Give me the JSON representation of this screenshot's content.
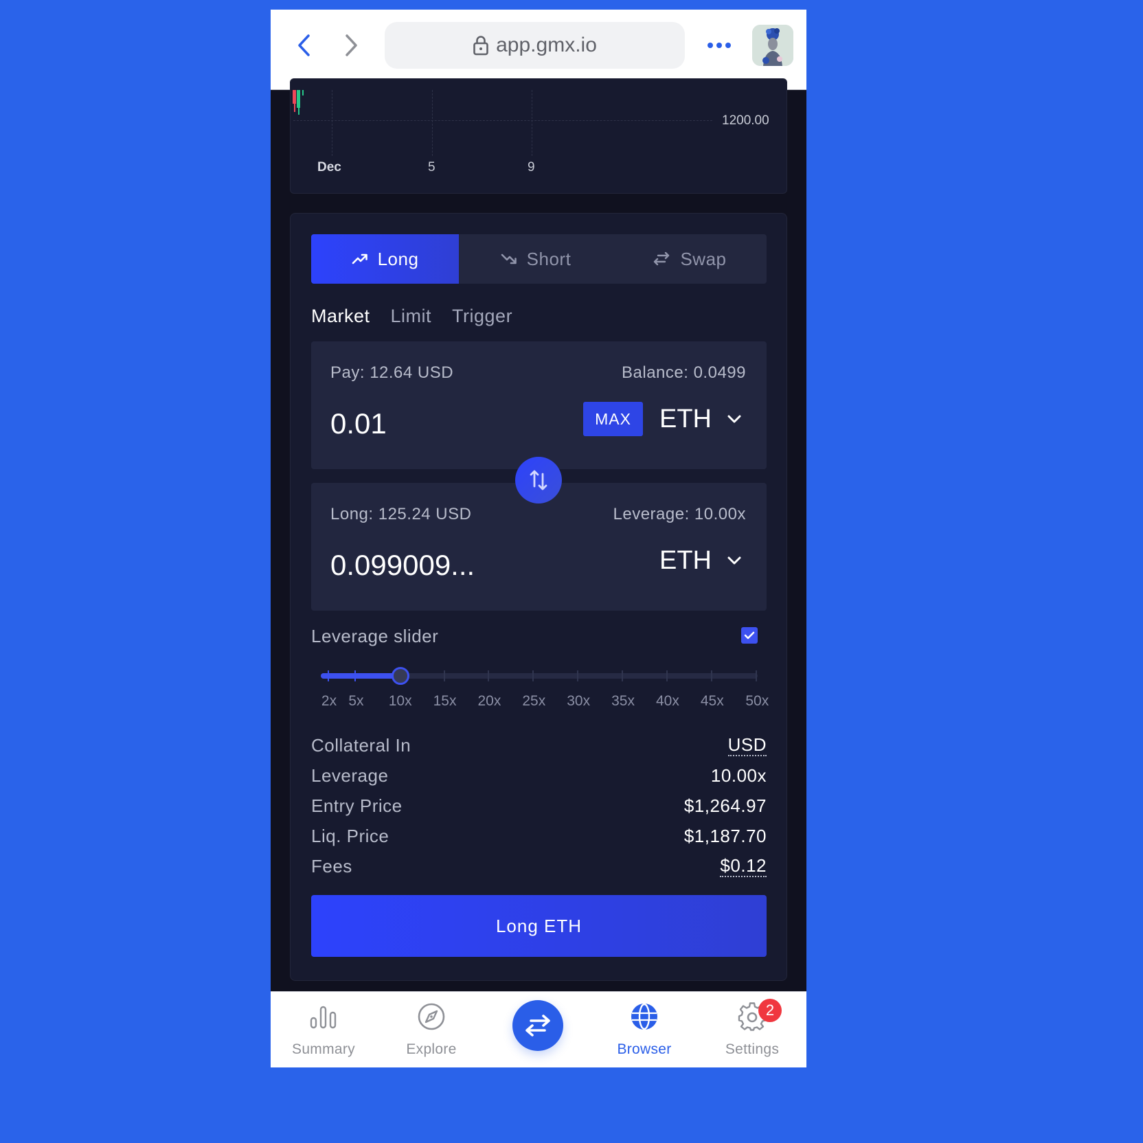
{
  "browser": {
    "url": "app.gmx.io",
    "icons": {
      "back": "chevron-left-icon",
      "forward": "chevron-right-icon",
      "lock": "lock-icon",
      "more": "more-horizontal-icon",
      "avatar": "avatar"
    }
  },
  "chart": {
    "price_label": "1200.00",
    "date_labels": [
      "Dec",
      "5",
      "9"
    ]
  },
  "trade": {
    "type_tabs": [
      {
        "label": "Long",
        "icon": "trend-up-icon",
        "active": true
      },
      {
        "label": "Short",
        "icon": "trend-down-icon",
        "active": false
      },
      {
        "label": "Swap",
        "icon": "swap-arrows-icon",
        "active": false
      }
    ],
    "order_tabs": [
      {
        "label": "Market",
        "active": true
      },
      {
        "label": "Limit",
        "active": false
      },
      {
        "label": "Trigger",
        "active": false
      }
    ],
    "pay": {
      "label": "Pay: 12.64 USD",
      "balance": "Balance: 0.0499",
      "value": "0.01",
      "max_label": "MAX",
      "token": "ETH"
    },
    "receive": {
      "label": "Long: 125.24 USD",
      "leverage": "Leverage: 10.00x",
      "value": "0.099009...",
      "token": "ETH"
    },
    "leverage_slider": {
      "label": "Leverage slider",
      "enabled": true,
      "value": 10,
      "min": 1.1,
      "max": 50,
      "marks": [
        "2x",
        "5x",
        "10x",
        "15x",
        "20x",
        "25x",
        "30x",
        "35x",
        "40x",
        "45x",
        "50x"
      ]
    },
    "info": [
      {
        "label": "Collateral In",
        "value": "USD",
        "dotted": true
      },
      {
        "label": "Leverage",
        "value": "10.00x",
        "dotted": false
      },
      {
        "label": "Entry Price",
        "value": "$1,264.97",
        "dotted": false
      },
      {
        "label": "Liq. Price",
        "value": "$1,187.70",
        "dotted": false
      },
      {
        "label": "Fees",
        "value": "$0.12",
        "dotted": true
      }
    ],
    "submit_label": "Long ETH"
  },
  "bottom_nav": {
    "items": [
      {
        "label": "Summary",
        "icon": "bar-chart-icon",
        "active": false
      },
      {
        "label": "Explore",
        "icon": "compass-icon",
        "active": false
      },
      {
        "label": "",
        "icon": "swap-arrows-icon",
        "active": false
      },
      {
        "label": "Browser",
        "icon": "globe-icon",
        "active": true
      },
      {
        "label": "Settings",
        "icon": "gear-icon",
        "active": false,
        "badge": "2"
      }
    ]
  },
  "colors": {
    "accent": "#2d42fc",
    "browser_blue": "#2a5ee8",
    "panel_bg": "#171a2f",
    "badge_red": "#f0373f"
  }
}
